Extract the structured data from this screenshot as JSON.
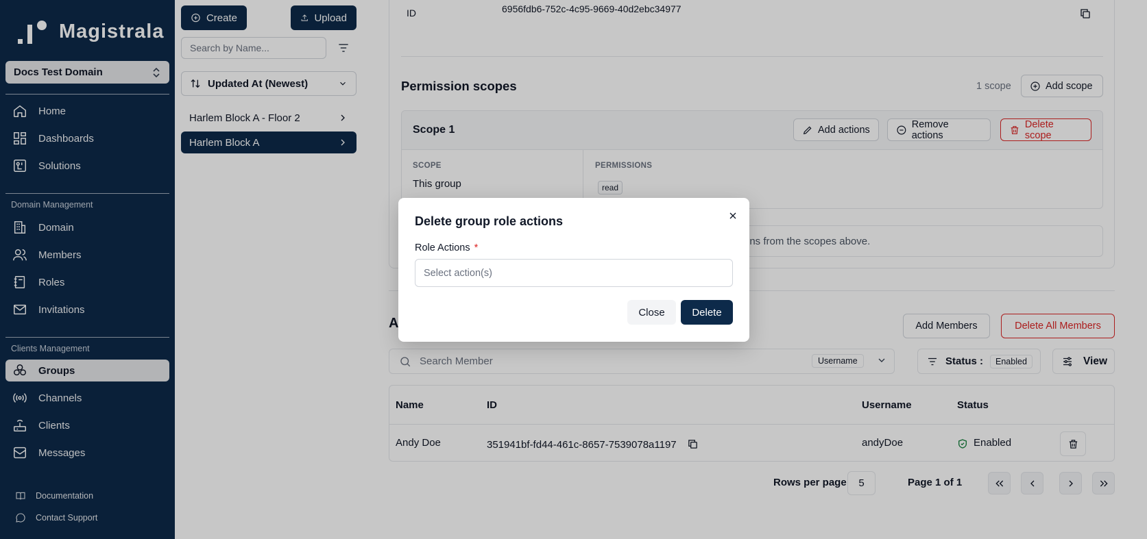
{
  "brand": {
    "name": "Magistrala"
  },
  "domain_select": {
    "value": "Docs Test Domain"
  },
  "nav": {
    "home": "Home",
    "dashboards": "Dashboards",
    "solutions": "Solutions",
    "domain_section": "Domain Management",
    "domain": "Domain",
    "members": "Members",
    "roles": "Roles",
    "invitations": "Invitations",
    "clients_section": "Clients Management",
    "groups": "Groups",
    "channels": "Channels",
    "clients": "Clients",
    "messages": "Messages"
  },
  "footer": {
    "documentation": "Documentation",
    "support": "Contact Support"
  },
  "groups_panel": {
    "create_label": "Create",
    "upload_label": "Upload",
    "search_placeholder": "Search by Name...",
    "sort_value": "Updated At (Newest)",
    "items": [
      {
        "name": "Harlem Block A - Floor 2"
      },
      {
        "name": "Harlem Block A"
      }
    ]
  },
  "details": {
    "id_label": "ID",
    "id_value": "6956fdb6-752c-4c95-9669-40d2ebc34977"
  },
  "permission_scopes": {
    "title": "Permission scopes",
    "count": "1 scope",
    "add_scope": "Add scope",
    "scope": {
      "name": "Scope 1",
      "add_actions": "Add actions",
      "remove_actions": "Remove actions",
      "delete_scope": "Delete scope",
      "scope_label": "SCOPE",
      "scope_value": "This group",
      "permissions_label": "PERMISSIONS",
      "permissions": [
        "read"
      ]
    },
    "hint": "ons from the scopes above."
  },
  "members": {
    "title": "A",
    "add_members": "Add Members",
    "delete_all": "Delete All Members",
    "search_placeholder": "Search Member",
    "search_field": "Username",
    "status_label": "Status :",
    "status_value": "Enabled",
    "view_label": "View",
    "columns": {
      "name": "Name",
      "id": "ID",
      "username": "Username",
      "status": "Status"
    },
    "rows": [
      {
        "name": "Andy Doe",
        "id": "351941bf-fd44-461c-8657-7539078a1197",
        "username": "andyDoe",
        "status": "Enabled"
      }
    ],
    "rows_per_page_label": "Rows per page",
    "rows_per_page_value": "5",
    "page_label": "Page 1 of 1"
  },
  "dialog": {
    "title": "Delete group role actions",
    "field_label": "Role Actions",
    "required_mark": "*",
    "placeholder": "Select action(s)",
    "close_label": "Close",
    "delete_label": "Delete"
  },
  "colors": {
    "primary": "#0d2a4a",
    "danger": "#dc2626",
    "success": "#15803d"
  }
}
